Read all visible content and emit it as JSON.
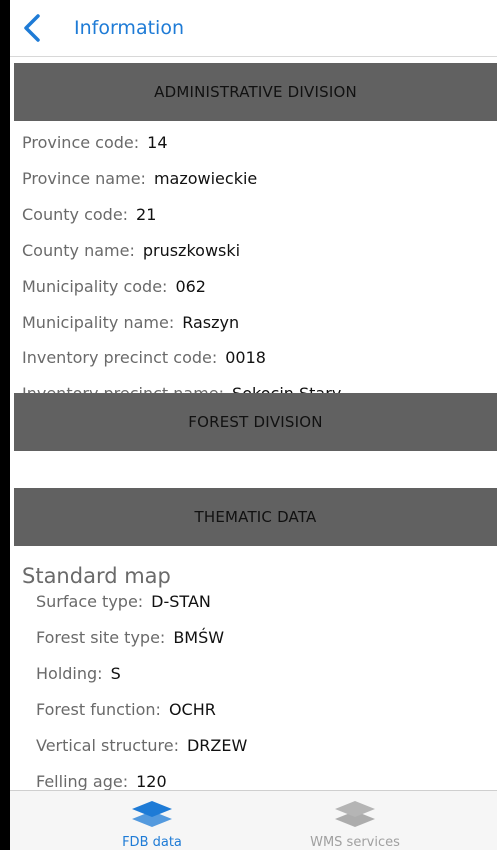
{
  "navbar": {
    "title": "Information"
  },
  "sections": {
    "administrative": {
      "title": "ADMINISTRATIVE DIVISION"
    },
    "forest": {
      "title": "FOREST DIVISION"
    },
    "thematic": {
      "title": "THEMATIC DATA"
    }
  },
  "admin_rows": [
    {
      "label": "Province code:",
      "value": "14"
    },
    {
      "label": "Province name:",
      "value": "mazowieckie"
    },
    {
      "label": "County code:",
      "value": "21"
    },
    {
      "label": "County name:",
      "value": "pruszkowski"
    },
    {
      "label": "Municipality code:",
      "value": "062"
    },
    {
      "label": "Municipality name:",
      "value": "Raszyn"
    },
    {
      "label": "Inventory precinct code:",
      "value": "0018"
    },
    {
      "label": "Inventory precinct name:",
      "value": "Sękocin Stary"
    }
  ],
  "thematic": {
    "subtitle": "Standard map",
    "rows": [
      {
        "label": "Surface type:",
        "value": "D-STAN"
      },
      {
        "label": "Forest site type:",
        "value": "BMŚW"
      },
      {
        "label": "Holding:",
        "value": "S"
      },
      {
        "label": "Forest function:",
        "value": "OCHR"
      },
      {
        "label": "Vertical structure:",
        "value": "DRZEW"
      },
      {
        "label": "Felling age:",
        "value": "120"
      }
    ]
  },
  "tabbar": {
    "tabs": [
      {
        "label": "FDB data",
        "active": true,
        "icon": "layers-icon"
      },
      {
        "label": "WMS services",
        "active": false,
        "icon": "layers-icon"
      }
    ]
  },
  "colors": {
    "accent": "#1e7bd6",
    "header_bg": "#616161",
    "inactive": "#a0a0a0"
  }
}
